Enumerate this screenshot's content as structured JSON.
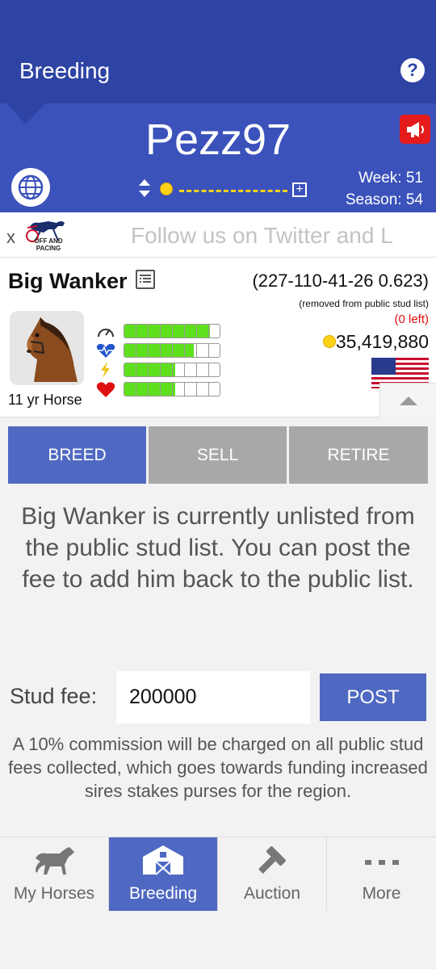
{
  "header": {
    "title": "Breeding",
    "help_icon": "question-circle-icon"
  },
  "user": {
    "username": "Pezz97",
    "week": "Week: 51",
    "season": "Season: 54",
    "brand_color": "#2e44a4"
  },
  "ad": {
    "close_label": "x",
    "logo_text": "OFF AND PACING",
    "text": "Follow us on Twitter and L"
  },
  "horse": {
    "name": "Big Wanker",
    "record": "(227-110-41-26 0.623)",
    "status_note": "(removed from public stud list)",
    "left_note": "(0 left)",
    "money": "35,419,880",
    "age": "11 yr Horse",
    "flag": "us-flag",
    "stats": [
      {
        "icon": "speedometer-icon",
        "level": 0.9
      },
      {
        "icon": "heartbeat-icon",
        "level": 0.73
      },
      {
        "icon": "lightning-icon",
        "level": 0.53
      },
      {
        "icon": "heart-icon",
        "level": 0.53
      }
    ]
  },
  "tabs": [
    {
      "label": "BREED",
      "active": true
    },
    {
      "label": "SELL",
      "active": false
    },
    {
      "label": "RETIRE",
      "active": false
    }
  ],
  "message": "Big Wanker is currently unlisted from the public stud list. You can post the fee to add him back to the public list.",
  "fee": {
    "label": "Stud fee:",
    "value": "200000",
    "post_label": "POST"
  },
  "commission_note": "A 10% commission will be charged on all public stud fees collected, which goes towards funding increased sires stakes purses for the region.",
  "nav": [
    {
      "label": "My Horses",
      "icon": "horse-icon",
      "active": false
    },
    {
      "label": "Breeding",
      "icon": "barn-icon",
      "active": true
    },
    {
      "label": "Auction",
      "icon": "gavel-icon",
      "active": false
    },
    {
      "label": "More",
      "icon": "more-dots-icon",
      "active": false
    }
  ]
}
